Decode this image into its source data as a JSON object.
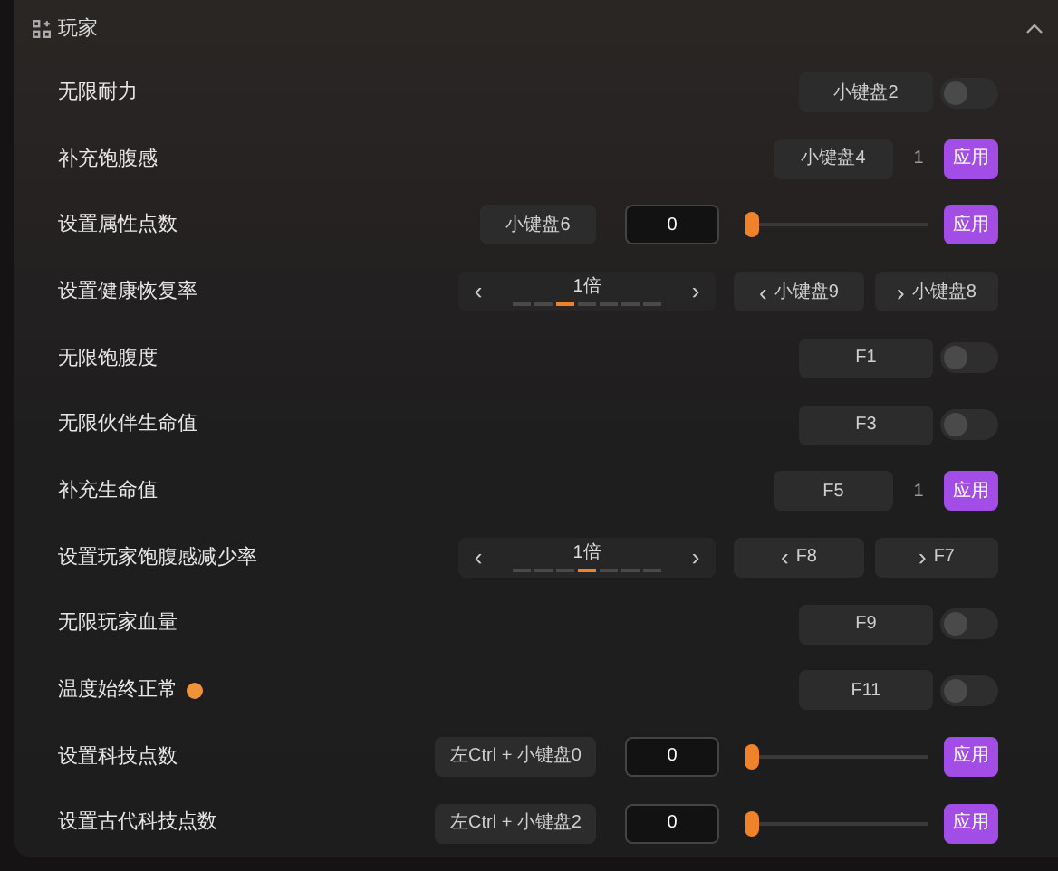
{
  "section": {
    "title": "玩家",
    "expanded": true
  },
  "rows": [
    {
      "kind": "toggle",
      "label": "无限耐力",
      "key": "小键盘2",
      "on": false
    },
    {
      "kind": "apply",
      "label": "补充饱腹感",
      "key": "小键盘4",
      "amount": "1",
      "button": "应用"
    },
    {
      "kind": "slider",
      "label": "设置属性点数",
      "key": "小键盘6",
      "value": "0",
      "level": 0,
      "button": "应用"
    },
    {
      "kind": "stepper",
      "label": "设置健康恢复率",
      "value": "1倍",
      "prev": "‹",
      "next": "›",
      "dots": [
        {
          "selected": false
        },
        {
          "selected": false
        },
        {
          "selected": true
        },
        {
          "selected": false
        },
        {
          "selected": false
        },
        {
          "selected": false
        },
        {
          "selected": false
        }
      ],
      "dec_key": "小键盘9",
      "inc_key": "小键盘8"
    },
    {
      "kind": "toggle",
      "label": "无限饱腹度",
      "key": "F1",
      "on": false
    },
    {
      "kind": "toggle",
      "label": "无限伙伴生命值",
      "key": "F3",
      "on": false
    },
    {
      "kind": "apply",
      "label": "补充生命值",
      "key": "F5",
      "amount": "1",
      "button": "应用"
    },
    {
      "kind": "stepper",
      "label": "设置玩家饱腹感减少率",
      "value": "1倍",
      "prev": "‹",
      "next": "›",
      "dots": [
        {
          "selected": false
        },
        {
          "selected": false
        },
        {
          "selected": false
        },
        {
          "selected": true
        },
        {
          "selected": false
        },
        {
          "selected": false
        },
        {
          "selected": false
        }
      ],
      "dec_key": "F8",
      "inc_key": "F7"
    },
    {
      "kind": "toggle",
      "label": "无限玩家血量",
      "key": "F9",
      "on": false
    },
    {
      "kind": "toggle",
      "label": "温度始终正常",
      "info": true,
      "key": "F11",
      "on": false
    },
    {
      "kind": "slider",
      "label": "设置科技点数",
      "key": "左Ctrl + 小键盘0",
      "value": "0",
      "level": 0,
      "button": "应用"
    },
    {
      "kind": "slider",
      "label": "设置古代科技点数",
      "key": "左Ctrl + 小键盘2",
      "value": "0",
      "level": 0,
      "button": "应用"
    }
  ]
}
